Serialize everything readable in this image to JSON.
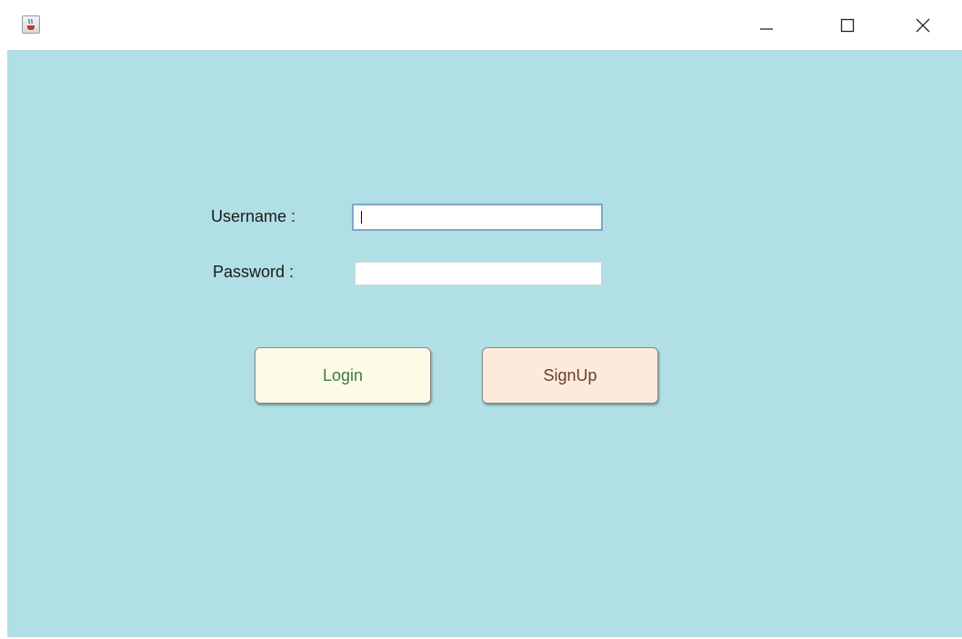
{
  "window": {
    "title": "",
    "icon": "java-cup-icon",
    "controls": {
      "minimize": "minimize-icon",
      "maximize": "maximize-icon",
      "close": "close-icon"
    }
  },
  "form": {
    "username_label": "Username :",
    "username_value": "",
    "password_label": "Password :",
    "password_value": ""
  },
  "buttons": {
    "login_label": "Login",
    "signup_label": "SignUp"
  },
  "colors": {
    "background": "#b0dfe5",
    "login_button_bg": "#fdfbe6",
    "login_button_text": "#3e7a3e",
    "signup_button_bg": "#fcebdc",
    "signup_button_text": "#6b3f22"
  }
}
